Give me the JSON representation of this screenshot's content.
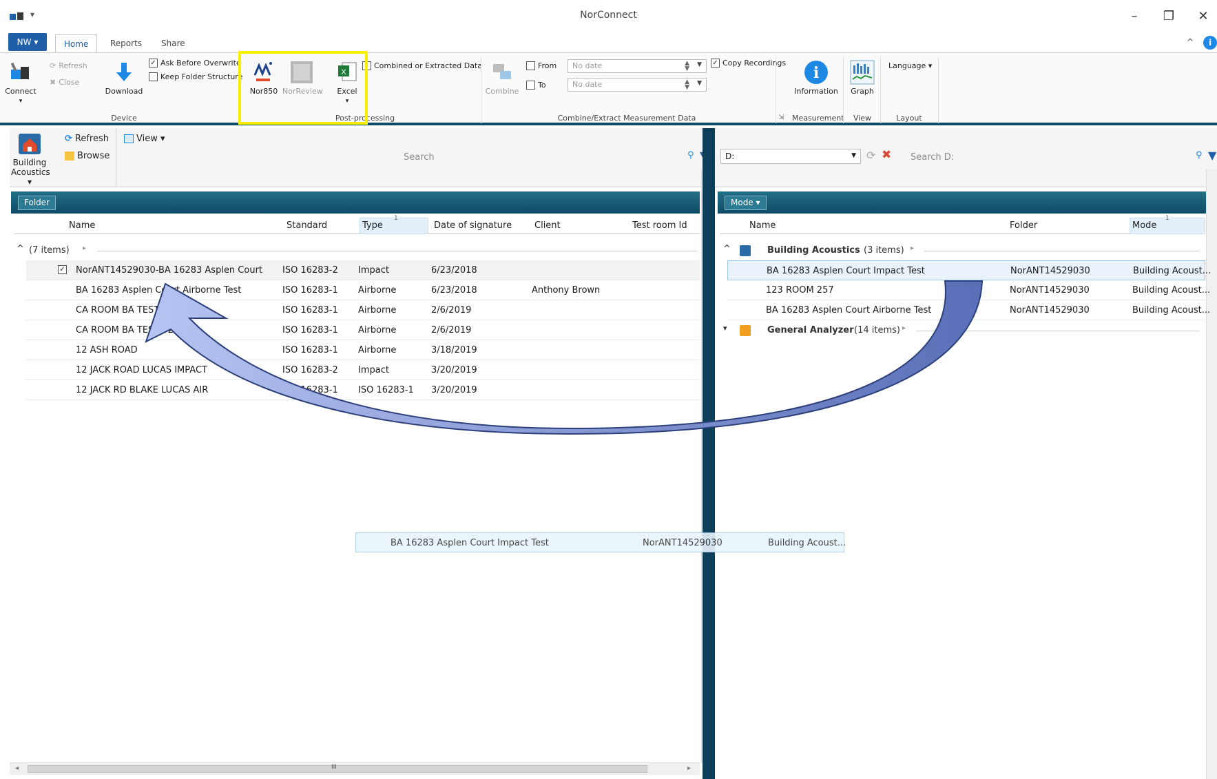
{
  "window": {
    "title": "NorConnect"
  },
  "tabs": {
    "app_menu": "NW ▾",
    "home": "Home",
    "reports": "Reports",
    "share": "Share"
  },
  "ribbon": {
    "device": {
      "label": "Device",
      "connect": "Connect",
      "refresh": "Refresh",
      "close": "Close",
      "download": "Download",
      "ask_overwrite": "Ask Before Overwrite",
      "keep_folder": "Keep Folder Structure"
    },
    "postprocessing": {
      "label": "Post-processing",
      "nor850": "Nor850",
      "norreview": "NorReview",
      "excel": "Excel",
      "combined": "Combined or Extracted Data"
    },
    "combine": {
      "label": "Combine/Extract Measurement Data",
      "combine": "Combine",
      "from": "From",
      "to": "To",
      "from_value": "No date",
      "to_value": "No date",
      "copy_recordings": "Copy Recordings"
    },
    "measurement": {
      "label": "Measurement",
      "information": "Information"
    },
    "view": {
      "label": "View",
      "graph": "Graph"
    },
    "layout": {
      "label": "Layout",
      "language": "Language ▾"
    }
  },
  "left": {
    "toolbar": {
      "building": "Building",
      "acoustics": "Acoustics ▾",
      "refresh": "Refresh",
      "browse": "Browse",
      "view": "View ▾"
    },
    "search_placeholder": "Search",
    "group_chip": "Folder",
    "columns": [
      "Name",
      "Standard",
      "Type",
      "Date of signature",
      "Client",
      "Test room Id"
    ],
    "sort_marker": "1",
    "group_label": "(7 items)",
    "rows": [
      [
        "NorANT14529030-BA 16283 Asplen Court I...",
        "ISO 16283-2",
        "Impact",
        "6/23/2018",
        "",
        ""
      ],
      [
        "BA 16283 Asplen Court Airborne Test",
        "ISO 16283-1",
        "Airborne",
        "6/23/2018",
        "Anthony Brown",
        ""
      ],
      [
        "CA ROOM BA TEST",
        "ISO 16283-1",
        "Airborne",
        "2/6/2019",
        "",
        ""
      ],
      [
        "CA ROOM BA TEST 02",
        "ISO 16283-1",
        "Airborne",
        "2/6/2019",
        "",
        ""
      ],
      [
        "12 ASH ROAD",
        "ISO 16283-1",
        "Airborne",
        "3/18/2019",
        "",
        ""
      ],
      [
        "12 JACK ROAD LUCAS IMPACT",
        "ISO 16283-2",
        "Impact",
        "3/20/2019",
        "",
        ""
      ],
      [
        "12 JACK RD BLAKE LUCAS AIR",
        "ISO 16283-1",
        "ISO 16283-1",
        "3/20/2019",
        "",
        ""
      ]
    ],
    "hscroll_grip": "III"
  },
  "right": {
    "drive": "D:",
    "search_placeholder": "Search D:",
    "group_chip": "Mode ▾",
    "columns": [
      "Name",
      "Folder",
      "Mode"
    ],
    "sort_marker": "1",
    "groups": [
      {
        "name": "Building Acoustics",
        "count": "(3 items)"
      },
      {
        "name": "General Analyzer",
        "count": "(14 items)"
      }
    ],
    "rows": [
      [
        "BA 16283 Asplen Court Impact Test",
        "NorANT14529030",
        "Building Acoust..."
      ],
      [
        "123 ROOM 257",
        "NorANT14529030",
        "Building Acoust..."
      ],
      [
        "BA 16283 Asplen Court Airborne Test",
        "NorANT14529030",
        "Building Acoust..."
      ]
    ]
  },
  "ghost": [
    "BA 16283 Asplen Court Impact Test",
    "NorANT14529030",
    "Building Acoust..."
  ],
  "colors": {
    "accent": "#1e5fa8",
    "panel_header": "#0e4a66",
    "highlight": "#f4f000",
    "arrow": "#7d92d6"
  }
}
